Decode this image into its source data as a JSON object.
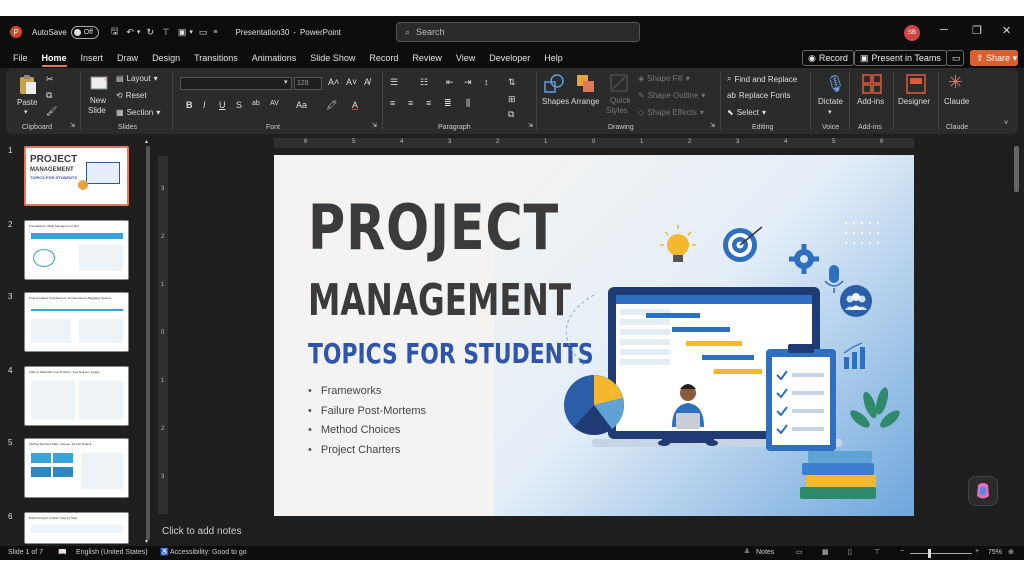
{
  "titlebar": {
    "autosave_label": "AutoSave",
    "autosave_state": "Off",
    "document_title": "Presentation30",
    "separator": "-",
    "app_name": "PowerPoint",
    "search_placeholder": "Search",
    "user_initials": "SB"
  },
  "menu": {
    "tabs": [
      "File",
      "Home",
      "Insert",
      "Draw",
      "Design",
      "Transitions",
      "Animations",
      "Slide Show",
      "Record",
      "Review",
      "View",
      "Developer",
      "Help"
    ],
    "active_tab": "Home",
    "record_label": "Record",
    "present_label": "Present in Teams",
    "share_label": "Share"
  },
  "ribbon": {
    "clipboard": {
      "paste": "Paste",
      "label": "Clipboard"
    },
    "slides": {
      "new_slide": "New",
      "new_slide2": "Slide",
      "layout": "Layout",
      "reset": "Reset",
      "section": "Section",
      "label": "Slides"
    },
    "font": {
      "size": "128",
      "label": "Font"
    },
    "paragraph": {
      "label": "Paragraph"
    },
    "drawing": {
      "shapes": "Shapes",
      "arrange": "Arrange",
      "quick_styles": "Quick",
      "quick_styles2": "Styles",
      "shape_fill": "Shape Fill",
      "shape_outline": "Shape Outline",
      "shape_effects": "Shape Effects",
      "label": "Drawing"
    },
    "editing": {
      "find_replace": "Find and Replace",
      "replace_fonts": "Replace Fonts",
      "select": "Select",
      "label": "Editing"
    },
    "voice": {
      "dictate": "Dictate",
      "label": "Voice"
    },
    "addins": {
      "addins": "Add-ins",
      "label": "Add-ins"
    },
    "designer": {
      "label": "Designer"
    },
    "claude": {
      "button": "Claude",
      "label": "Claude"
    }
  },
  "thumbnails": {
    "numbers": [
      "1",
      "2",
      "3",
      "4",
      "5",
      "6"
    ],
    "t1_title": "PROJECT",
    "t1_sub": "MANAGEMENT",
    "t1_sub2": "TOPICS FOR STUDENTS",
    "t2_title": "Foundations: What Managers Control",
    "t3_title": "Project Failure Post-Mortem: Human Report Baggage System",
    "t4_title": "Agile or Waterfall: One Problem, Two Delivery Logics",
    "t5_title": "Method Decision Map: Choose, Do Not Default",
    "t6_title": "Build A Project Charter Step by Step"
  },
  "ruler": {
    "top": [
      "6",
      "5",
      "4",
      "3",
      "2",
      "1",
      "0",
      "1",
      "2",
      "3",
      "4",
      "5",
      "6"
    ],
    "left": [
      "3",
      "2",
      "1",
      "0",
      "1",
      "2",
      "3"
    ]
  },
  "slide": {
    "title_line1": "PROJECT",
    "title_line2": "MANAGEMENT",
    "subtitle": "TOPICS FOR STUDENTS",
    "bullets": [
      "Frameworks",
      "Failure Post-Mortems",
      "Method Choices",
      "Project Charters"
    ]
  },
  "notes": {
    "placeholder": "Click to add notes"
  },
  "status": {
    "slide_counter": "Slide 1 of 7",
    "language": "English (United States)",
    "accessibility": "Accessibility: Good to go",
    "notes_label": "Notes",
    "zoom": "75%"
  },
  "colors": {
    "accent": "#e0785a",
    "share": "#d9602f",
    "title_gray": "#3b3b3b",
    "subtitle_blue": "#2f55a8"
  }
}
